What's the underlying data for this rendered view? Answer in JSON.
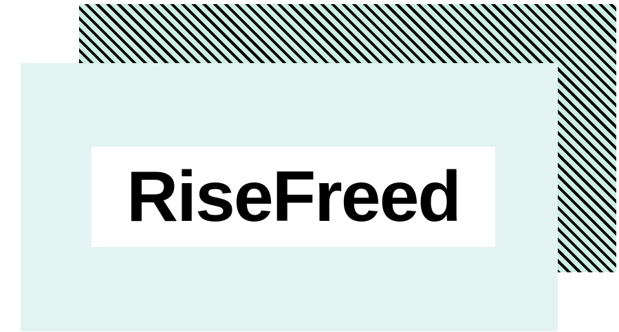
{
  "logo": {
    "text": "RiseFreed"
  },
  "colors": {
    "stripe_light": "#cdeee3",
    "stripe_dark": "#000000",
    "card_background": "#e2f3f2",
    "title_box_background": "#ffffff",
    "title_text": "#000000"
  }
}
